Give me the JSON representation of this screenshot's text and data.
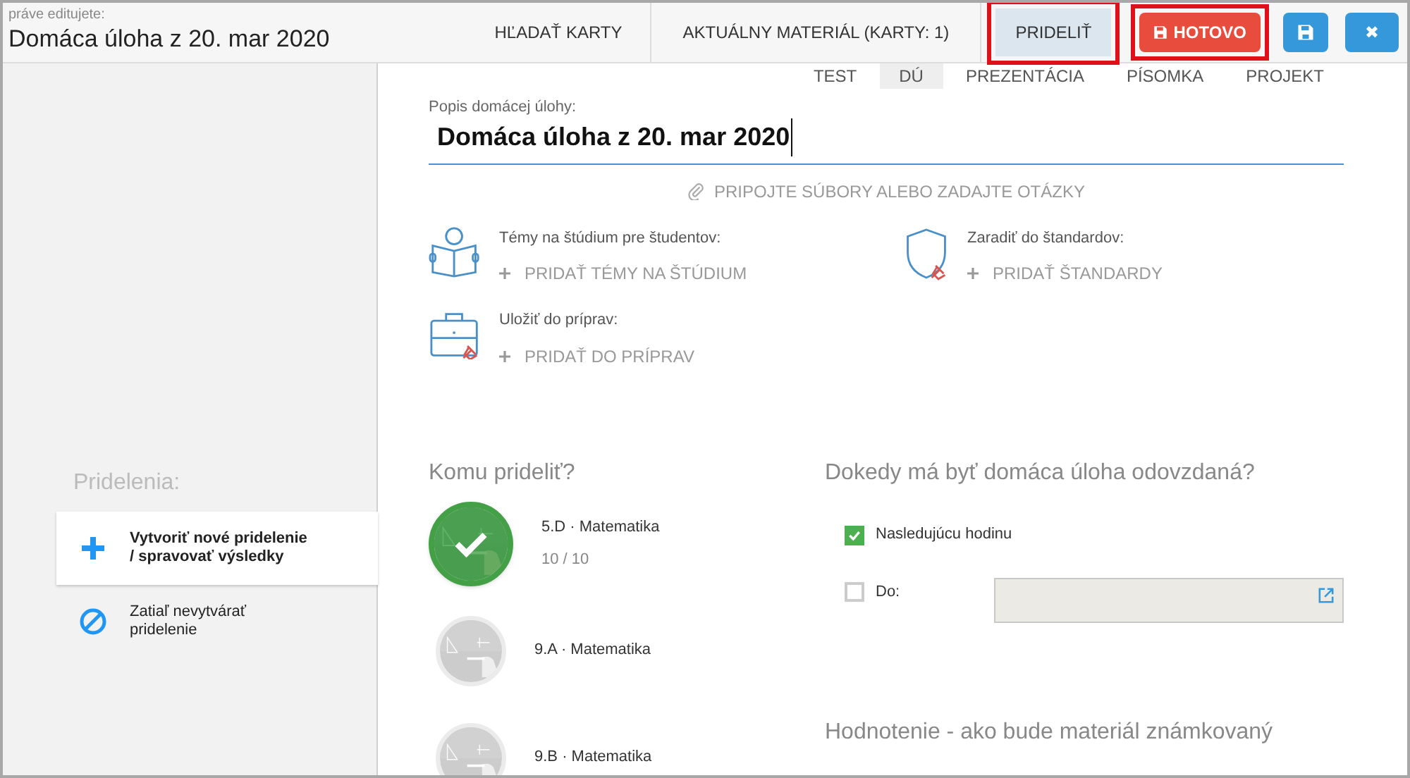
{
  "header": {
    "caption": "práve editujete:",
    "title": "Domáca úloha z 20. mar 2020"
  },
  "toolbar": [
    {
      "kind": "link",
      "label": "HĽADAŤ KARTY",
      "selected": false,
      "highlighted": false
    },
    {
      "kind": "link",
      "label": "AKTUÁLNY MATERIÁL (KARTY: 1)",
      "selected": false,
      "highlighted": false
    },
    {
      "kind": "link",
      "label": "PRIDELIŤ",
      "selected": true,
      "highlighted": true
    },
    {
      "kind": "primary",
      "label": "HOTOVO",
      "highlighted": true
    },
    {
      "kind": "save",
      "highlighted": false
    },
    {
      "kind": "close",
      "label": "✖",
      "highlighted": false
    }
  ],
  "tabs": [
    {
      "label": "TEST",
      "selected": false
    },
    {
      "label": "DÚ",
      "selected": true
    },
    {
      "label": "PREZENTÁCIA",
      "selected": false
    },
    {
      "label": "PÍSOMKA",
      "selected": false
    },
    {
      "label": "PROJEKT",
      "selected": false
    }
  ],
  "description": {
    "label": "Popis domácej úlohy:",
    "value": "Domáca úloha z 20. mar 2020"
  },
  "attach": {
    "label": "PRIPOJTE SÚBORY ALEBO ZADAJTE OTÁZKY"
  },
  "sections": [
    {
      "kind": "topics",
      "title": "Témy na štúdium pre študentov:",
      "action": "PRIDAŤ TÉMY NA ŠTÚDIUM"
    },
    {
      "kind": "standards",
      "title": "Zaradiť do štandardov:",
      "action": "PRIDAŤ ŠTANDARDY"
    },
    {
      "kind": "prep",
      "title": "Uložiť do príprav:",
      "action": "PRIDAŤ DO PRÍPRAV"
    }
  ],
  "sidebar": {
    "title": "Pridelenia:",
    "items": [
      {
        "kind": "create",
        "label": "Vytvoriť nové pridelenie / spravovať výsledky",
        "selected": true
      },
      {
        "kind": "none",
        "label": "Zatiaľ nevytvárať pridelenie",
        "selected": false
      }
    ]
  },
  "recipients": {
    "title": "Komu prideliť?",
    "classes": [
      {
        "name": "5.D · Matematika",
        "count": "10 / 10",
        "selected": true
      },
      {
        "name": "9.A · Matematika",
        "selected": false
      },
      {
        "name": "9.B · Matematika",
        "selected": false
      }
    ]
  },
  "due": {
    "title": "Dokedy má byť domáca úloha odovzdaná?",
    "options": [
      {
        "kind": "plain",
        "label": "Nasledujúcu hodinu",
        "checked": true
      },
      {
        "kind": "date",
        "label": "Do:",
        "checked": false
      }
    ]
  },
  "grading": {
    "title": "Hodnotenie - ako bude materiál známkovaný"
  }
}
